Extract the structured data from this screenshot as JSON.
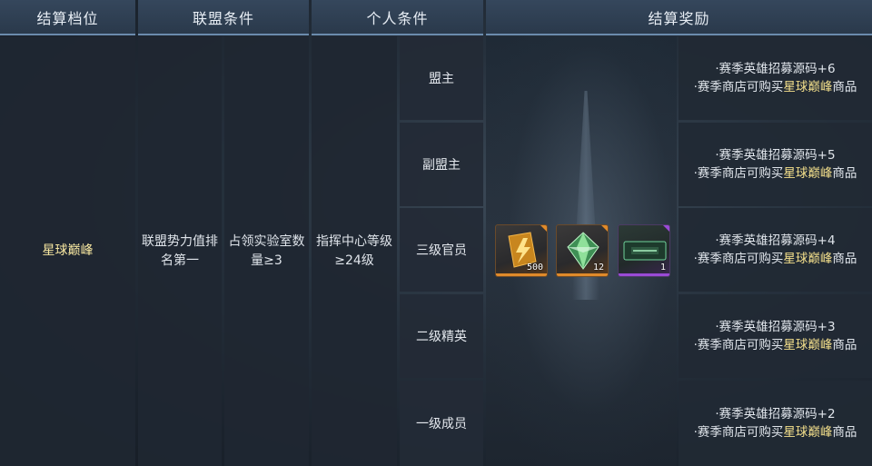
{
  "headers": {
    "tier": "结算档位",
    "alliance": "联盟条件",
    "personal": "个人条件",
    "reward": "结算奖励"
  },
  "tier_name": "星球巅峰",
  "alliance_conditions": {
    "power_rank": "联盟势力值排名第一",
    "lab_count": "占领实验室数量≥3"
  },
  "personal_condition": "指挥中心等级≥24级",
  "ranks": [
    "盟主",
    "副盟主",
    "三级官员",
    "二级精英",
    "一级成员"
  ],
  "reward_items": [
    {
      "icon": "orange-lightning-card-icon",
      "qty": "500",
      "rarity_color": "#e08a2a"
    },
    {
      "icon": "green-crystal-icon",
      "qty": "12",
      "rarity_color": "#e08a2a"
    },
    {
      "icon": "purple-badge-card-icon",
      "qty": "1",
      "rarity_color": "#9a4ad6"
    }
  ],
  "rank_rewards": [
    {
      "line1": "·赛季英雄招募源码+6",
      "line2_prefix": "·赛季商店可购买",
      "line2_highlight": "星球巅峰",
      "line2_suffix": "商品"
    },
    {
      "line1": "·赛季英雄招募源码+5",
      "line2_prefix": "·赛季商店可购买",
      "line2_highlight": "星球巅峰",
      "line2_suffix": "商品"
    },
    {
      "line1": "·赛季英雄招募源码+4",
      "line2_prefix": "·赛季商店可购买",
      "line2_highlight": "星球巅峰",
      "line2_suffix": "商品"
    },
    {
      "line1": "·赛季英雄招募源码+3",
      "line2_prefix": "·赛季商店可购买",
      "line2_highlight": "星球巅峰",
      "line2_suffix": "商品"
    },
    {
      "line1": "·赛季英雄招募源码+2",
      "line2_prefix": "·赛季商店可购买",
      "line2_highlight": "星球巅峰",
      "line2_suffix": "商品"
    }
  ],
  "colors": {
    "header_accent": "#6b8bad",
    "highlight_text": "#f4e08c",
    "tier_text": "#f6e6a0"
  }
}
